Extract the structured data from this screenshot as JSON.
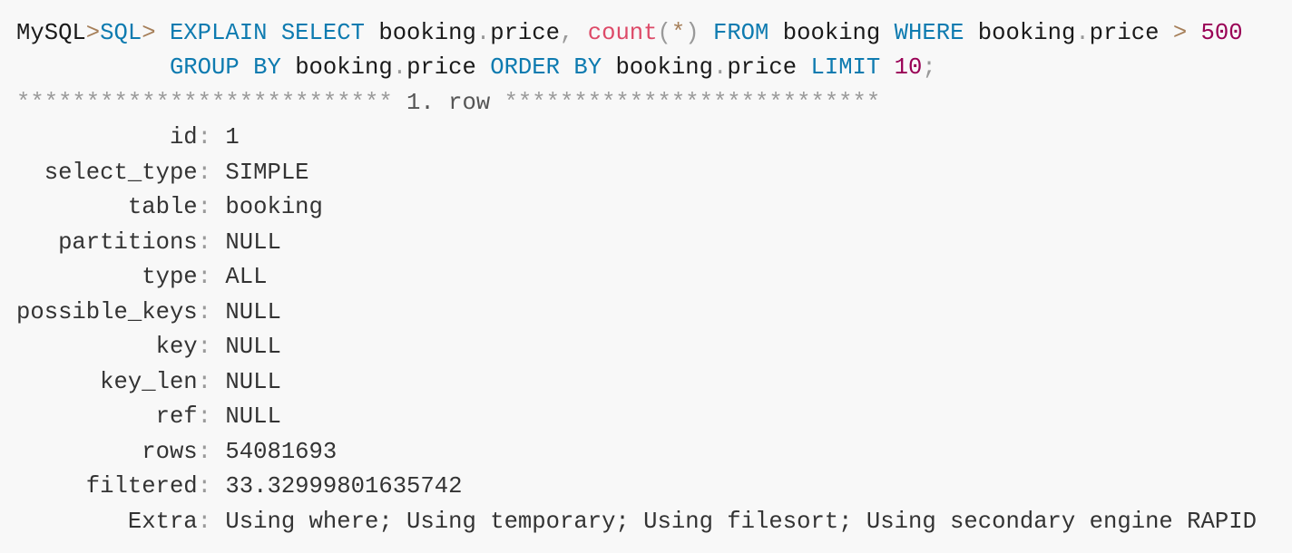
{
  "terminal": {
    "prompt": {
      "product": "MySQL",
      "arrow1": ">",
      "mode": "SQL",
      "arrow2": ">"
    },
    "query": {
      "line1": {
        "explain": "EXPLAIN",
        "select": "SELECT",
        "col1_table": "booking",
        "col1_dot": ".",
        "col1_field": "price",
        "comma": ",",
        "count_fn": "count",
        "paren_open": "(",
        "star": "*",
        "paren_close": ")",
        "from": "FROM",
        "from_table": "booking",
        "where": "WHERE",
        "where_table": "booking",
        "where_dot": ".",
        "where_field": "price",
        "gt": ">",
        "gt_value": "500"
      },
      "line2": {
        "group_by": "GROUP BY",
        "group_table": "booking",
        "group_dot": ".",
        "group_field": "price",
        "order_by": "ORDER BY",
        "order_table": "booking",
        "order_dot": ".",
        "order_field": "price",
        "limit": "LIMIT",
        "limit_value": "10",
        "semicolon": ";"
      }
    },
    "row_separator": {
      "stars_left": "***************************",
      "label": "1. row",
      "stars_right": "***************************"
    },
    "fields": [
      {
        "name": "id",
        "value": "1"
      },
      {
        "name": "select_type",
        "value": "SIMPLE"
      },
      {
        "name": "table",
        "value": "booking"
      },
      {
        "name": "partitions",
        "value": "NULL"
      },
      {
        "name": "type",
        "value": "ALL"
      },
      {
        "name": "possible_keys",
        "value": "NULL"
      },
      {
        "name": "key",
        "value": "NULL"
      },
      {
        "name": "key_len",
        "value": "NULL"
      },
      {
        "name": "ref",
        "value": "NULL"
      },
      {
        "name": "rows",
        "value": "54081693"
      },
      {
        "name": "filtered",
        "value": "33.32999801635742"
      },
      {
        "name": "Extra",
        "value": "Using where; Using temporary; Using filesort; Using secondary engine RAPID"
      }
    ],
    "colors": {
      "background": "#f8f8f8",
      "keyword": "#0e7bb0",
      "operator": "#a67f59",
      "function": "#dd4a68",
      "number": "#990055",
      "punctuation": "#999999"
    }
  }
}
